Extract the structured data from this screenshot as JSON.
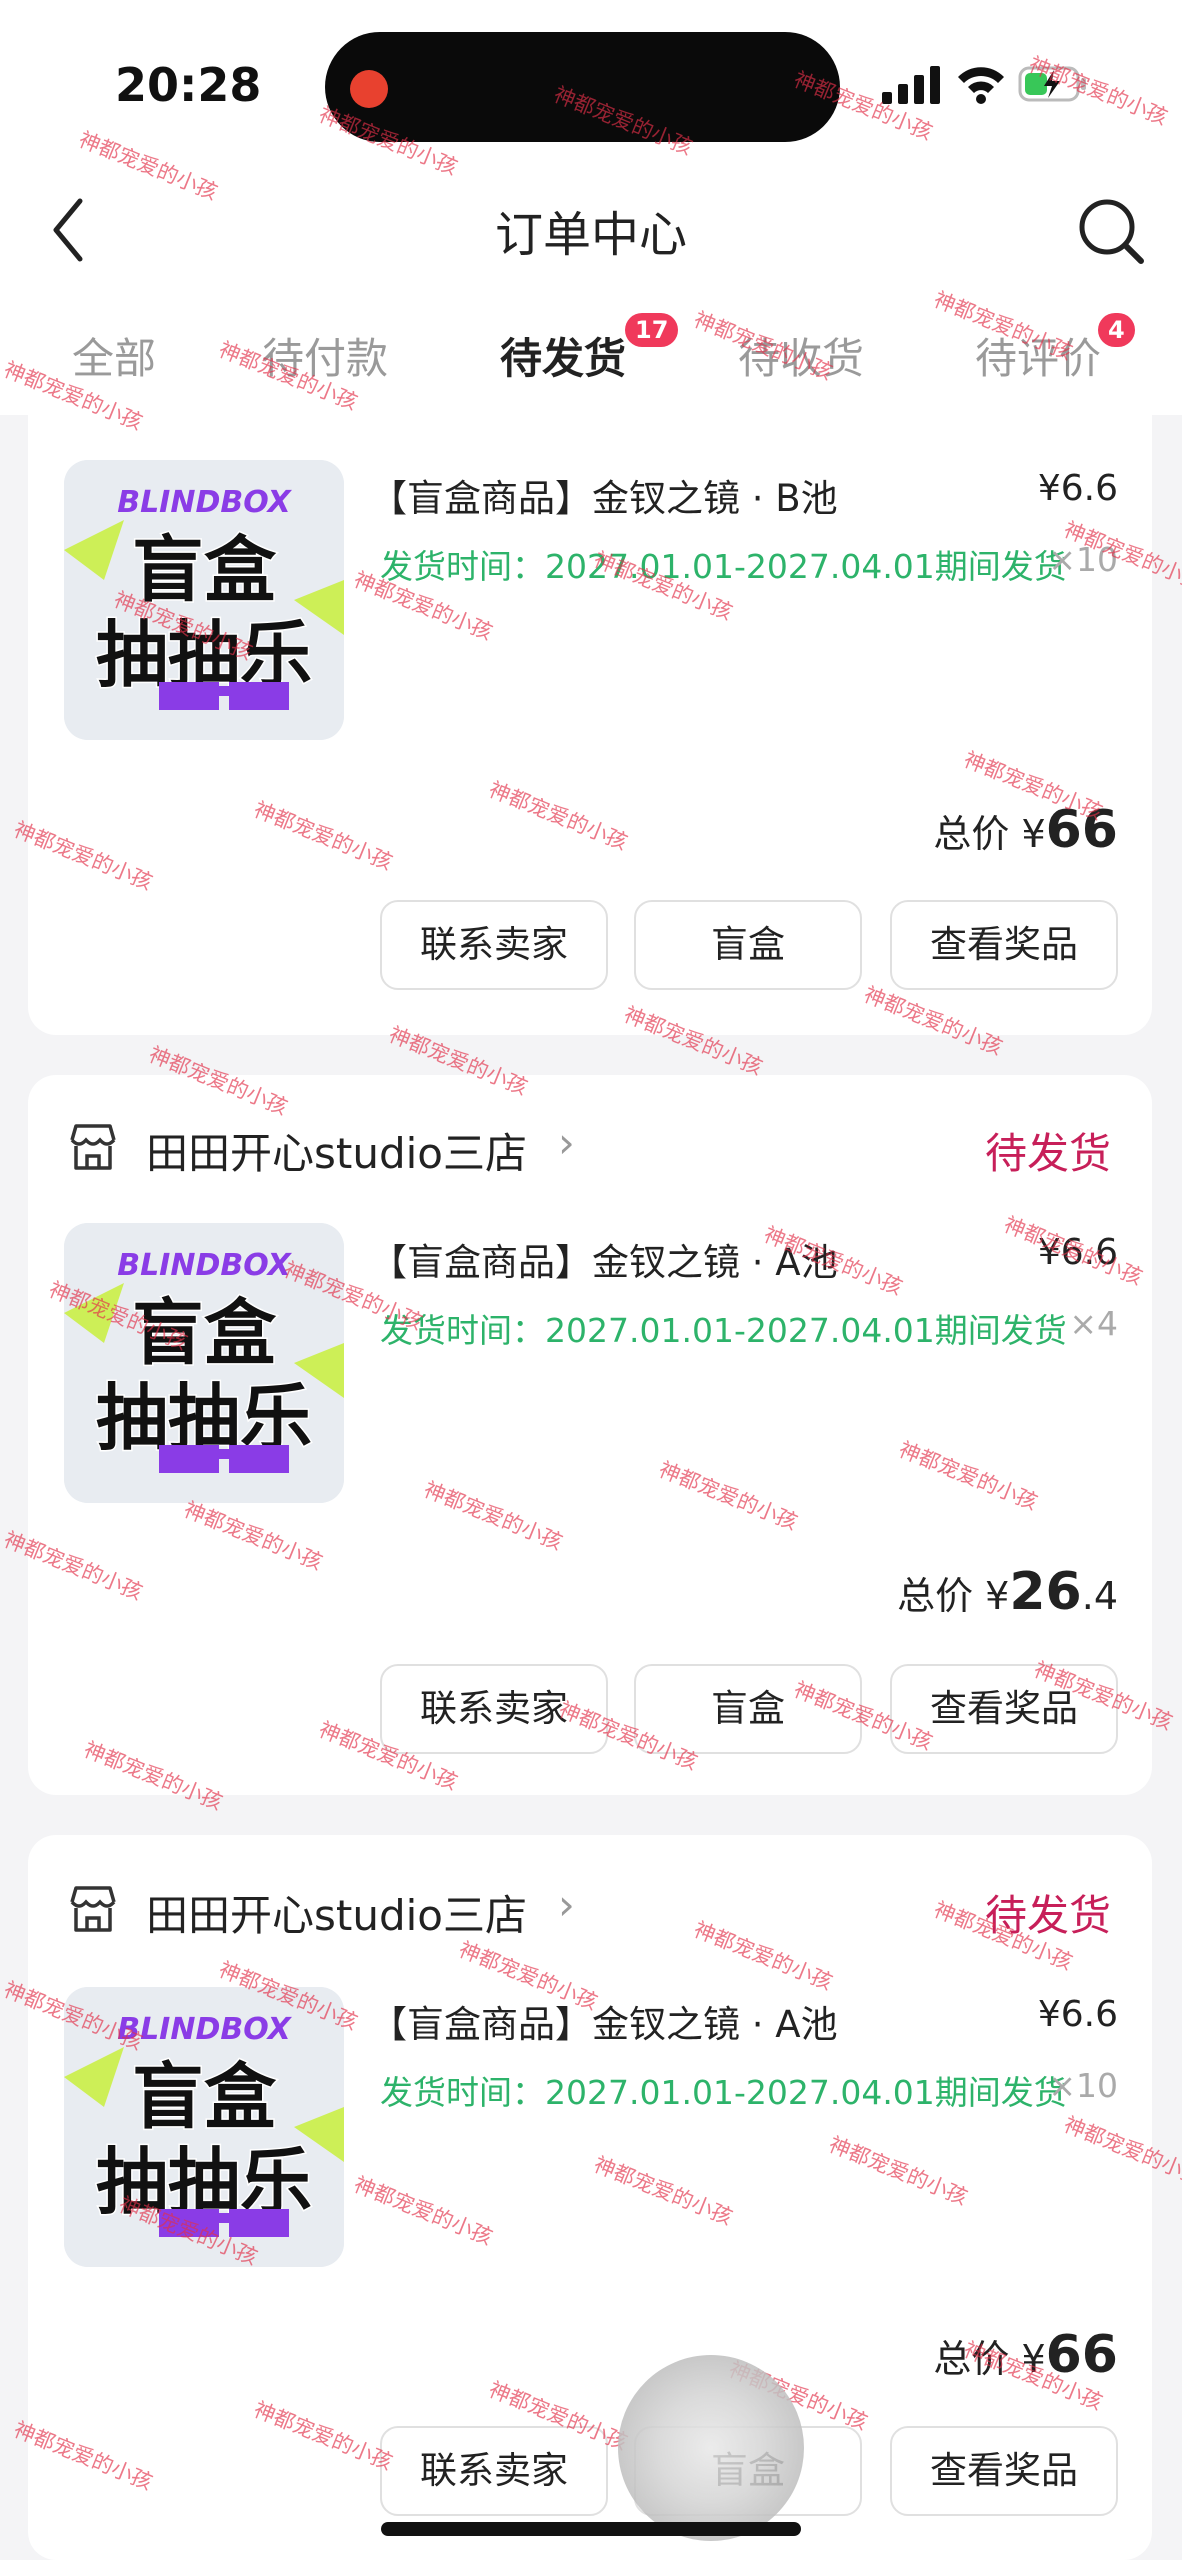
{
  "status_bar": {
    "time": "20:28"
  },
  "header": {
    "title": "订单中心"
  },
  "tabs": [
    {
      "label": "全部"
    },
    {
      "label": "待付款"
    },
    {
      "label": "待发货",
      "badge": "17",
      "active": true
    },
    {
      "label": "待收货"
    },
    {
      "label": "待评价",
      "badge": "4"
    }
  ],
  "thumbnail": {
    "brand": "BLINDBOX",
    "line1": "盲盒",
    "line2": "抽抽乐"
  },
  "orders": [
    {
      "product_name": "【盲盒商品】金钗之镜 · B池",
      "price": "¥6.6",
      "ship_time": "发货时间：2027.01.01-2027.04.01期间发货",
      "quantity": "×10",
      "total_label": "总价",
      "total_currency": "¥",
      "total_int": "66",
      "total_dec": "",
      "buttons": [
        "联系卖家",
        "盲盒",
        "查看奖品"
      ]
    },
    {
      "store_name": "田田开心studio三店",
      "status": "待发货",
      "product_name": "【盲盒商品】金钗之镜 · A池",
      "price": "¥6.6",
      "ship_time": "发货时间：2027.01.01-2027.04.01期间发货",
      "quantity": "×4",
      "total_label": "总价",
      "total_currency": "¥",
      "total_int": "26",
      "total_dec": ".4",
      "buttons": [
        "联系卖家",
        "盲盒",
        "查看奖品"
      ]
    },
    {
      "store_name": "田田开心studio三店",
      "status": "待发货",
      "product_name": "【盲盒商品】金钗之镜 · A池",
      "price": "¥6.6",
      "ship_time": "发货时间：2027.01.01-2027.04.01期间发货",
      "quantity": "×10",
      "total_label": "总价",
      "total_currency": "¥",
      "total_int": "66",
      "total_dec": "",
      "buttons": [
        "联系卖家",
        "盲盒",
        "查看奖品"
      ]
    }
  ],
  "watermark": "神都宠爱的小孩",
  "colors": {
    "accent": "#f0395b",
    "status": "#c71f59",
    "ship": "#2db36a"
  }
}
